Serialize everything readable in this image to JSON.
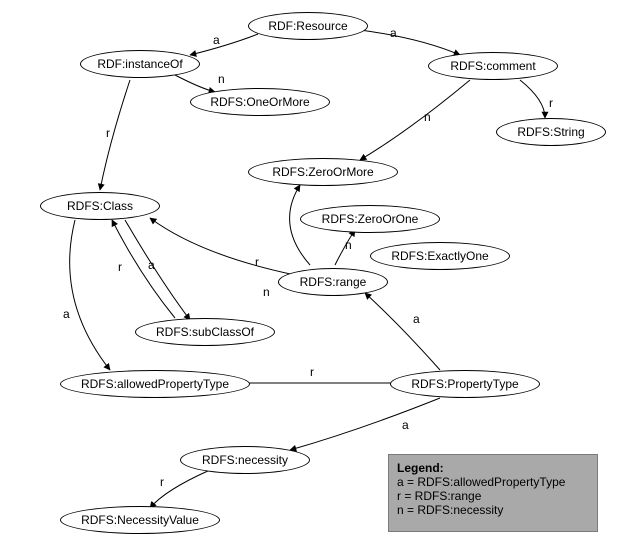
{
  "nodes": {
    "resource": {
      "label": "RDF:Resource"
    },
    "instanceOf": {
      "label": "RDF:instanceOf"
    },
    "comment": {
      "label": "RDFS:comment"
    },
    "oneOrMore": {
      "label": "RDFS:OneOrMore"
    },
    "string": {
      "label": "RDFS:String"
    },
    "zeroOrMore": {
      "label": "RDFS:ZeroOrMore"
    },
    "class": {
      "label": "RDFS:Class"
    },
    "zeroOrOne": {
      "label": "RDFS:ZeroOrOne"
    },
    "exactlyOne": {
      "label": "RDFS:ExactlyOne"
    },
    "range": {
      "label": "RDFS:range"
    },
    "subClassOf": {
      "label": "RDFS:subClassOf"
    },
    "allowedPT": {
      "label": "RDFS:allowedPropertyType"
    },
    "propertyType": {
      "label": "RDFS:PropertyType"
    },
    "necessity": {
      "label": "RDFS:necessity"
    },
    "necessityValue": {
      "label": "RDFS:NecessityValue"
    }
  },
  "edge_labels": {
    "a": "a",
    "r": "r",
    "n": "n"
  },
  "legend": {
    "title": "Legend:",
    "a": "a = RDFS:allowedPropertyType",
    "r": "r = RDFS:range",
    "n": "n = RDFS:necessity"
  }
}
